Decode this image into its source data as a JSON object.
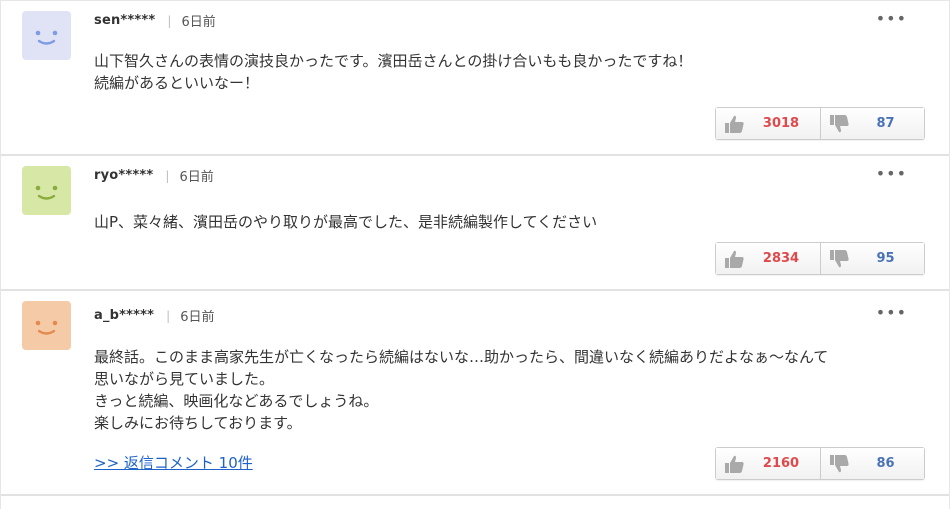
{
  "comments": [
    {
      "username": "sen*****",
      "time": "6日前",
      "lines": [
        "山下智久さんの表情の演技良かったです。濱田岳さんとの掛け合いもも良かったですね！",
        "続編があるといいなー！"
      ],
      "likes": "3018",
      "dislikes": "87",
      "avatar_color": "#dfe3f5",
      "avatar_face_color": "#7f9be6"
    },
    {
      "username": "ryo*****",
      "time": "6日前",
      "lines": [
        "山P、菜々緒、濱田岳のやり取りが最高でした、是非続編製作してください"
      ],
      "likes": "2834",
      "dislikes": "95",
      "avatar_color": "#d7e8a6",
      "avatar_face_color": "#8bab3d"
    },
    {
      "username": "a_b*****",
      "time": "6日前",
      "lines": [
        "最終話。このまま高家先生が亡くなったら続編はないな…助かったら、間違いなく続編ありだよなぁ～なんて",
        "思いながら見ていました。",
        "きっと続編、映画化などあるでしょうね。",
        "楽しみにお待ちしております。"
      ],
      "reply_link": ">> 返信コメント 10件",
      "likes": "2160",
      "dislikes": "86",
      "avatar_color": "#f5cba7",
      "avatar_face_color": "#e48a4f"
    }
  ],
  "separator": "|",
  "more_icon": "•••",
  "colors": {
    "like_count": "#e0494b",
    "dislike_count": "#4a73b6",
    "link": "#1e62c9"
  }
}
